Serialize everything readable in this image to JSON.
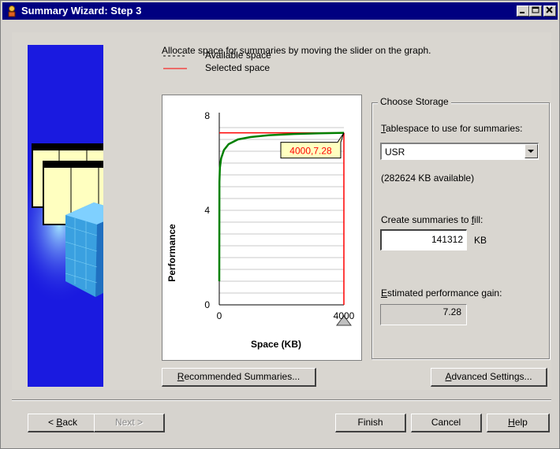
{
  "window": {
    "title": "Summary Wizard: Step 3"
  },
  "instructions": "Allocate space for summaries by moving the slider on the graph.",
  "legend": {
    "available": "Available space",
    "selected": "Selected space"
  },
  "chart_data": {
    "type": "line",
    "xlabel": "Space (KB)",
    "ylabel": "Performance",
    "xlim": [
      0,
      4000
    ],
    "ylim": [
      0,
      8
    ],
    "x_ticks": [
      "0",
      "4000"
    ],
    "y_ticks": [
      "0",
      "4",
      "8"
    ],
    "grid": true,
    "series": [
      {
        "x": [
          0,
          5,
          20,
          60,
          150,
          300,
          600,
          1000,
          1600,
          2400,
          3200,
          4000
        ],
        "y": [
          1.0,
          5.2,
          5.8,
          6.2,
          6.55,
          6.8,
          7.0,
          7.1,
          7.18,
          7.23,
          7.26,
          7.28
        ]
      }
    ],
    "selected": {
      "x": 4000,
      "y": 7.28,
      "label": "4000,7.28"
    },
    "colors": {
      "curve": "#008000",
      "selected": "#ff0000",
      "callout_bg": "#ffffc0",
      "callout_text": "#ff0000"
    }
  },
  "storage": {
    "group_label": "Choose Storage",
    "tablespace_label_u": "T",
    "tablespace_label_rest": "ablespace to use for summaries:",
    "tablespace_value": "USR",
    "available_text": "(282624 KB available)",
    "fill_label_pre": "Create summaries to ",
    "fill_label_u": "f",
    "fill_label_post": "ill:",
    "fill_value": "141312",
    "fill_unit": "KB",
    "gain_label_u": "E",
    "gain_label_rest": "stimated performance gain:",
    "gain_value": "7.28"
  },
  "buttons": {
    "recommended_u": "R",
    "recommended_rest": "ecommended Summaries...",
    "advanced_u": "A",
    "advanced_rest": "dvanced Settings...",
    "back_pre": "< ",
    "back_u": "B",
    "back_rest": "ack",
    "next": "Next >",
    "finish": "Finish",
    "cancel": "Cancel",
    "help_u": "H",
    "help_rest": "elp"
  }
}
